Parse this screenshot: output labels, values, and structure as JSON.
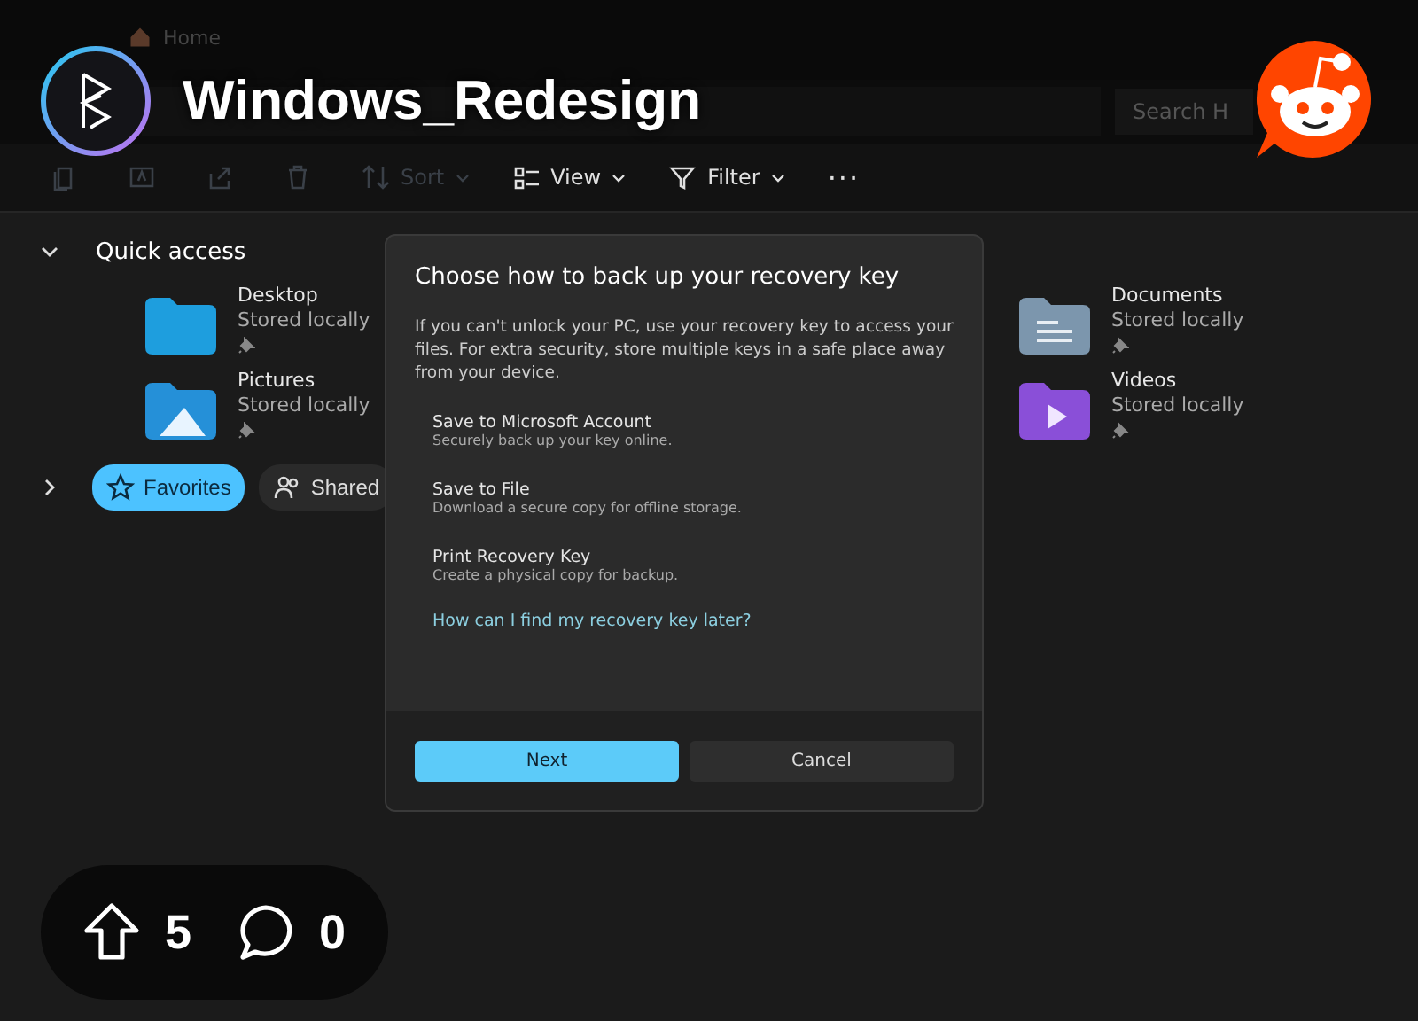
{
  "explorer": {
    "tab": {
      "title": "Home"
    },
    "search": {
      "placeholder": "Search H"
    },
    "toolbar": [
      {
        "kind": "icon",
        "disabled": true
      },
      {
        "kind": "icon",
        "disabled": true
      },
      {
        "kind": "icon",
        "disabled": true
      },
      {
        "kind": "icon",
        "disabled": true
      },
      {
        "kind": "menu",
        "label": "Sort",
        "disabled": true
      },
      {
        "kind": "menu",
        "label": "View",
        "disabled": false
      },
      {
        "kind": "menu",
        "label": "Filter",
        "disabled": false
      },
      {
        "kind": "more",
        "label": "···"
      }
    ],
    "quick_access": {
      "title": "Quick access",
      "expanded": true,
      "items": [
        {
          "name": "Desktop",
          "status": "Stored locally",
          "pinned": true
        },
        {
          "name": "Documents",
          "status": "Stored locally",
          "pinned": true
        },
        {
          "name": "Pictures",
          "status": "Stored locally",
          "pinned": true
        },
        {
          "name": "Videos",
          "status": "Stored locally",
          "pinned": true
        }
      ]
    },
    "sections": {
      "expanded": false,
      "chips": [
        {
          "label": "Favorites",
          "selected": true
        },
        {
          "label": "Shared",
          "selected": false
        }
      ]
    }
  },
  "dialog": {
    "title": "Choose how to back up your recovery key",
    "body": "If you can't unlock your PC, use your recovery key to access your files. For extra security, store multiple keys in a safe place away from your device.",
    "options": [
      {
        "title": "Save to Microsoft Account",
        "subtitle": "Securely back up your key online."
      },
      {
        "title": "Save to File",
        "subtitle": "Download a secure copy for offline storage."
      },
      {
        "title": "Print Recovery Key",
        "subtitle": "Create a physical copy for backup."
      }
    ],
    "link": "How can I find my recovery key later?",
    "buttons": [
      {
        "label": "Next",
        "primary": true
      },
      {
        "label": "Cancel",
        "primary": false
      }
    ]
  },
  "post": {
    "subreddit": "Windows_Redesign",
    "upvotes": "5",
    "comments": "0"
  }
}
